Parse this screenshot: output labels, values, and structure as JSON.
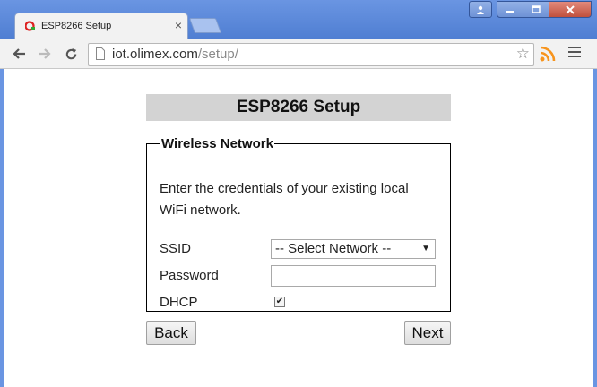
{
  "browser": {
    "tab_title": "ESP8266 Setup",
    "tab_close": "×",
    "url_host": "iot.olimex.com",
    "url_path": "/setup/",
    "star": "☆"
  },
  "page": {
    "title": "ESP8266 Setup",
    "fieldset_legend": "Wireless Network",
    "intro": "Enter the credentials of your existing local WiFi network.",
    "ssid_label": "SSID",
    "ssid_selected": "-- Select Network --",
    "password_label": "Password",
    "password_value": "",
    "dhcp_label": "DHCP",
    "dhcp_checked": true,
    "dhcp_check": "✔",
    "back_label": "Back",
    "next_label": "Next"
  },
  "colors": {
    "titlebar": "#5a86d6",
    "heading_bg": "#d3d3d3",
    "rss": "#f7941d"
  }
}
